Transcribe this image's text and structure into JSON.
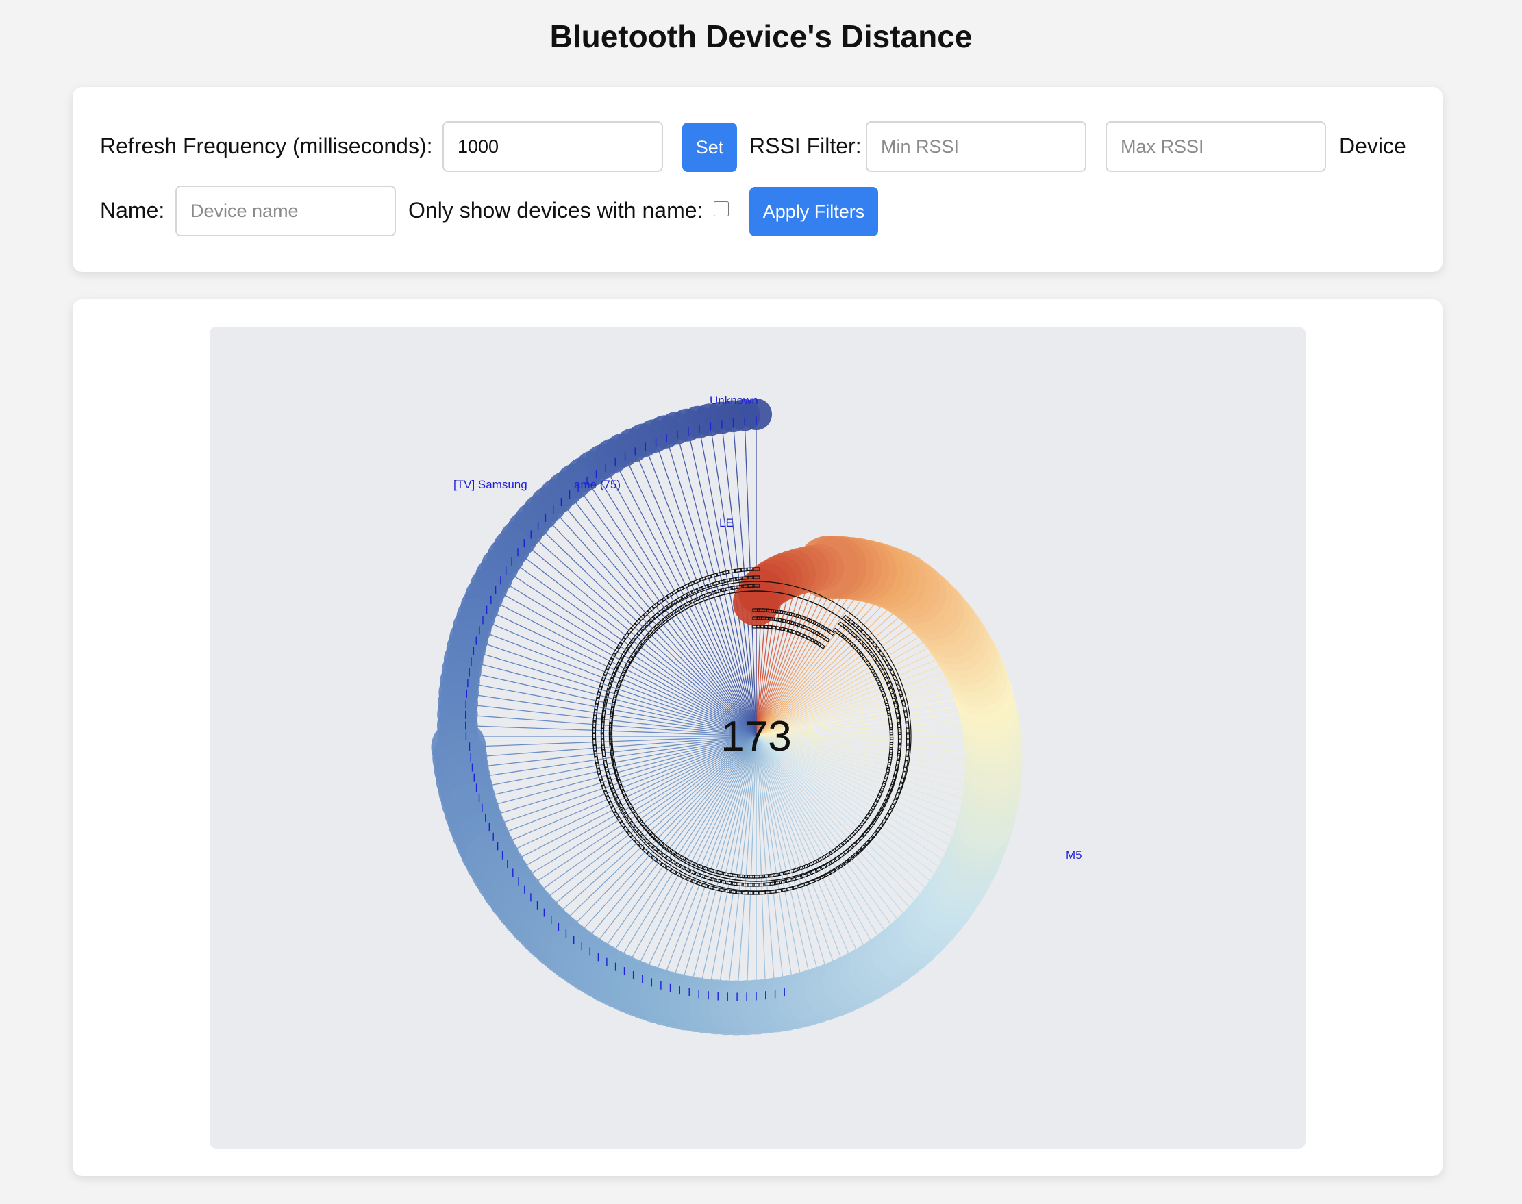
{
  "page": {
    "title": "Bluetooth Device's Distance"
  },
  "controls": {
    "refresh_label": "Refresh Frequency (milliseconds):",
    "refresh_value": "1000",
    "set_button": "Set",
    "rssi_label": "RSSI Filter:",
    "min_rssi_placeholder": "Min RSSI",
    "max_rssi_placeholder": "Max RSSI",
    "device_name_label_part1": "Device",
    "device_name_label_part2": "Name:",
    "device_name_placeholder": "Device name",
    "only_named_label": "Only show devices with name:",
    "only_named_checked": false,
    "apply_button": "Apply Filters"
  },
  "visualization": {
    "center_count": "173",
    "visible_labels": {
      "top": "Unknown",
      "samsung": "[TV] Samsung",
      "samsung_suffix": "ame (75)",
      "le": "LE",
      "m5": "M5"
    },
    "colors": {
      "background": "#eaebef",
      "label_text": "#1f1fd8",
      "near_red": "#c8422e",
      "orange": "#f0a868",
      "yellow": "#fbf3c6",
      "light_blue": "#c9e3ee",
      "mid_blue": "#8ab2d4",
      "deep_blue": "#3b4f9d"
    }
  }
}
